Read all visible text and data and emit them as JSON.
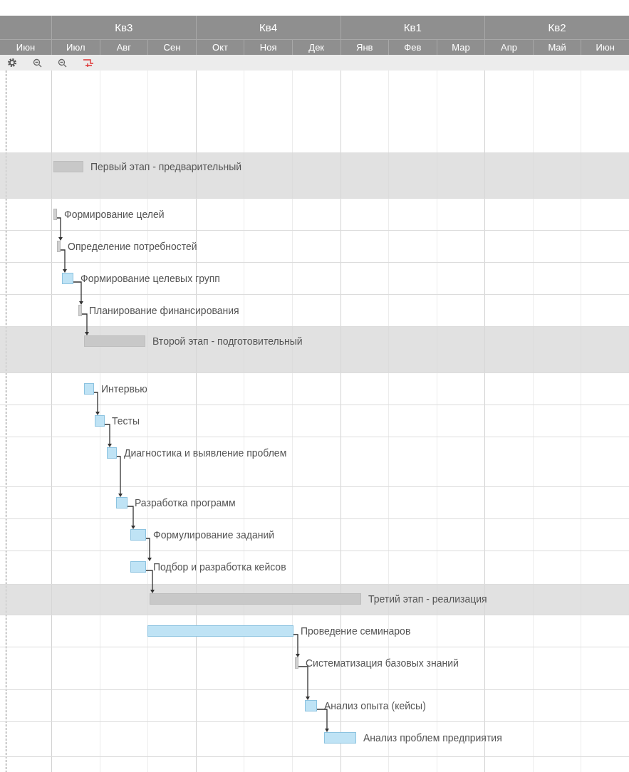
{
  "timeline": {
    "quarters": [
      "Кв3",
      "Кв4",
      "Кв1",
      "Кв2"
    ],
    "months": [
      "Июн",
      "Июл",
      "Авг",
      "Сен",
      "Окт",
      "Ноя",
      "Дек",
      "Янв",
      "Фев",
      "Мар",
      "Апр",
      "Май",
      "Июн"
    ]
  },
  "tasks": [
    {
      "kind": "summary",
      "name": "Первый этап - предварительный"
    },
    {
      "kind": "task",
      "name": "Формирование целей"
    },
    {
      "kind": "task",
      "name": "Определение потребностей"
    },
    {
      "kind": "task",
      "name": "Формирование целевых групп"
    },
    {
      "kind": "task",
      "name": "Планирование финансирования"
    },
    {
      "kind": "summary",
      "name": "Второй этап - подготовительный"
    },
    {
      "kind": "task",
      "name": "Интервью"
    },
    {
      "kind": "task",
      "name": "Тесты"
    },
    {
      "kind": "task",
      "name": "Диагностика и выявление проблем"
    },
    {
      "kind": "task",
      "name": "Разработка программ"
    },
    {
      "kind": "task",
      "name": "Формулирование заданий"
    },
    {
      "kind": "task",
      "name": "Подбор и разработка кейсов"
    },
    {
      "kind": "summary",
      "name": "Третий этап - реализация"
    },
    {
      "kind": "task",
      "name": "Проведение семинаров"
    },
    {
      "kind": "task",
      "name": "Систематизация базовых знаний"
    },
    {
      "kind": "task",
      "name": "Анализ опыта (кейсы)"
    },
    {
      "kind": "task",
      "name": "Анализ проблем предприятия"
    }
  ]
}
